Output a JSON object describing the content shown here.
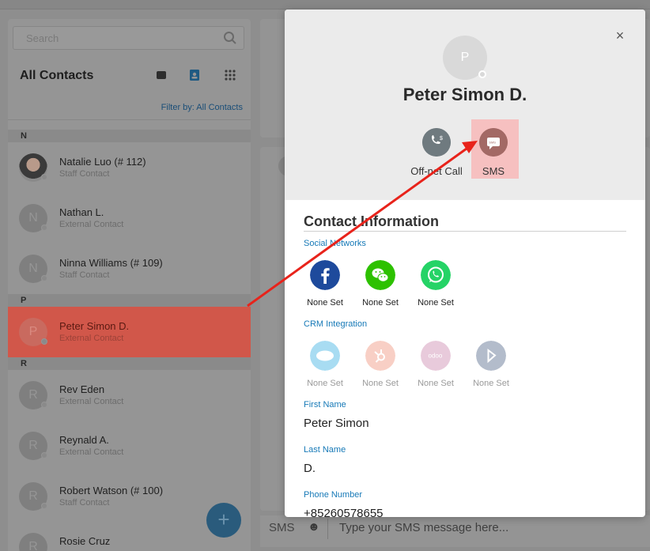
{
  "search": {
    "placeholder": "Search"
  },
  "panel": {
    "title": "All Contacts",
    "filter": "Filter by: All Contacts",
    "sections": [
      "N",
      "P",
      "R"
    ],
    "contacts": [
      {
        "name": "Natalie Luo (# 112)",
        "sub": "Staff Contact",
        "initial": ""
      },
      {
        "name": "Nathan L.",
        "sub": "External Contact",
        "initial": "N"
      },
      {
        "name": "Ninna Williams (# 109)",
        "sub": "Staff Contact",
        "initial": "N"
      },
      {
        "name": "Peter Simon D.",
        "sub": "External Contact",
        "initial": "P"
      },
      {
        "name": "Rev Eden",
        "sub": "External Contact",
        "initial": "R"
      },
      {
        "name": "Reynald A.",
        "sub": "External Contact",
        "initial": "R"
      },
      {
        "name": "Robert Watson (# 100)",
        "sub": "Staff Contact",
        "initial": "R"
      },
      {
        "name": "Rosie Cruz",
        "sub": "",
        "initial": "R"
      }
    ],
    "fab": "+"
  },
  "sms_bar": {
    "label": "SMS",
    "emoji": "☻",
    "placeholder": "Type your SMS message here..."
  },
  "modal": {
    "close": "×",
    "avatar_initial": "P",
    "name": "Peter Simon D.",
    "actions": [
      {
        "label": "Off-net Call",
        "icon": "phone-dollar-icon"
      },
      {
        "label": "SMS",
        "icon": "sms-icon"
      }
    ],
    "contact_info_title": "Contact Information",
    "social_networks_label": "Social Networks",
    "social": [
      {
        "icon": "facebook-icon",
        "label": "None Set",
        "color": "#1e4a9c"
      },
      {
        "icon": "wechat-icon",
        "label": "None Set",
        "color": "#2dc100"
      },
      {
        "icon": "whatsapp-icon",
        "label": "None Set",
        "color": "#25d366"
      }
    ],
    "crm_label": "CRM Integration",
    "crm": [
      {
        "icon": "salesforce-icon",
        "label": "None Set",
        "color": "#9fd6f0"
      },
      {
        "icon": "hubspot-icon",
        "label": "None Set",
        "color": "#f6c7bd"
      },
      {
        "icon": "odoo-icon",
        "label": "None Set",
        "color": "#e6c6d8"
      },
      {
        "icon": "dynamics-icon",
        "label": "None Set",
        "color": "#aeb8c6"
      }
    ],
    "fields": [
      {
        "label": "First Name",
        "value": "Peter Simon"
      },
      {
        "label": "Last Name",
        "value": "D."
      },
      {
        "label": "Phone Number",
        "value": "+85260578655"
      }
    ]
  },
  "colors": {
    "accent": "#1679b7",
    "highlight": "#d1574a",
    "arrow": "#e8231b"
  }
}
